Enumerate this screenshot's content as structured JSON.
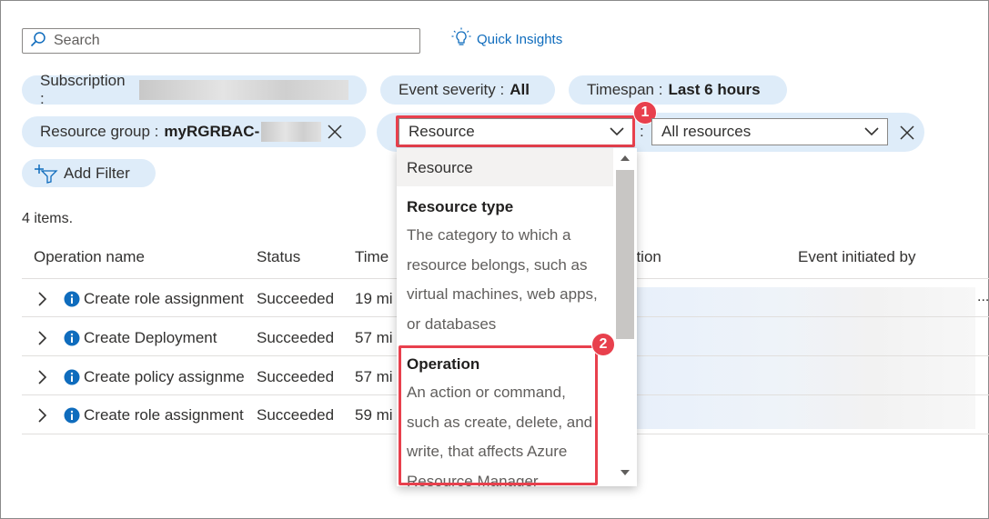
{
  "search": {
    "placeholder": "Search"
  },
  "quick_insights": {
    "label": "Quick Insights"
  },
  "filters": {
    "subscription_label": "Subscription :",
    "event_severity_label": "Event severity :",
    "event_severity_value": "All",
    "timespan_label": "Timespan :",
    "timespan_value": "Last 6 hours",
    "resource_group_label": "Resource group :",
    "resource_group_value": "myRGRBAC-",
    "field_dropdown_value": "Resource",
    "separator": ":",
    "value_dropdown_value": "All resources",
    "add_filter_label": "Add Filter"
  },
  "items_count": "4 items.",
  "table": {
    "columns": [
      "Operation name",
      "Status",
      "Time",
      "ption",
      "Event initiated by"
    ],
    "rows": [
      {
        "operation": "Create role assignment",
        "status": "Succeeded",
        "time": "19 mi"
      },
      {
        "operation": "Create Deployment",
        "status": "Succeeded",
        "time": "57 mi"
      },
      {
        "operation": "Create policy assignment",
        "status": "Succeeded",
        "time": "57 mi"
      },
      {
        "operation": "Create role assignment",
        "status": "Succeeded",
        "time": "59 mi"
      }
    ],
    "overflow_ellipsis": "..."
  },
  "menu": {
    "resource_item": "Resource",
    "resource_type_title": "Resource type",
    "resource_type_desc_lines": [
      "The category to which a",
      "resource belongs, such as",
      "virtual machines, web apps,",
      "or databases"
    ],
    "operation_title": "Operation",
    "operation_desc_lines": [
      "An action or command,",
      "such as create, delete, and",
      "write, that affects Azure",
      "Resource Manager"
    ]
  },
  "badges": {
    "one": "1",
    "two": "2"
  },
  "colors": {
    "accent": "#0f6cbd",
    "pill": "#deecf9",
    "highlight": "#e8404d",
    "info": "#0f6cbd"
  }
}
